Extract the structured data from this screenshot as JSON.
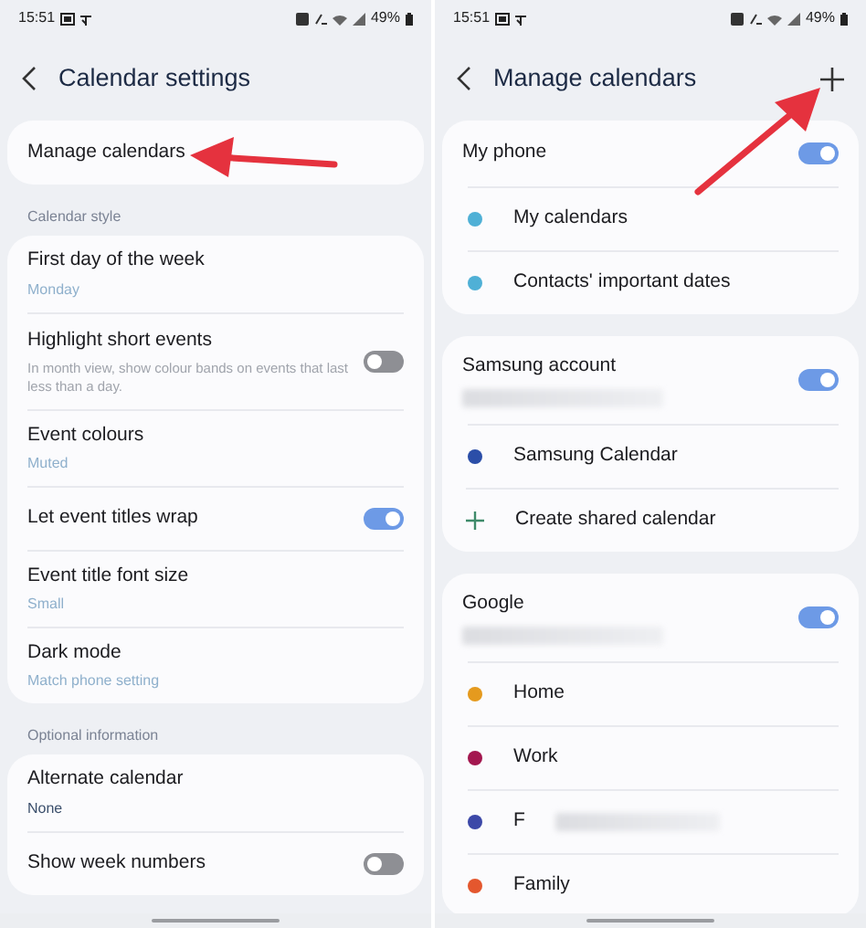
{
  "screens": [
    {
      "status_bar": {
        "time": "15:51",
        "battery": "49%"
      },
      "title": "Calendar settings",
      "add_button": false,
      "pointer_arrow": true,
      "sections": [
        {
          "items": [
            {
              "kind": "setting",
              "title": "Manage calendars"
            }
          ]
        },
        {
          "label": "Calendar style",
          "items": [
            {
              "kind": "setting",
              "title": "First day of the week",
              "value": "Monday"
            },
            {
              "kind": "setting",
              "title": "Highlight short events",
              "description": "In month view, show colour bands on events that last less than a day.",
              "toggle": {
                "on": false
              }
            },
            {
              "kind": "setting",
              "title": "Event colours",
              "value": "Muted"
            },
            {
              "kind": "setting",
              "title": "Let event titles wrap",
              "toggle": {
                "on": true
              }
            },
            {
              "kind": "setting",
              "title": "Event title font size",
              "value": "Small"
            },
            {
              "kind": "setting",
              "title": "Dark mode",
              "value": "Match phone setting"
            }
          ]
        },
        {
          "label": "Optional information",
          "items": [
            {
              "kind": "setting",
              "title": "Alternate calendar",
              "value": "None",
              "value_strong": true
            },
            {
              "kind": "setting",
              "title": "Show week numbers",
              "toggle": {
                "on": false
              }
            }
          ]
        }
      ]
    },
    {
      "status_bar": {
        "time": "15:51",
        "battery": "49%"
      },
      "title": "Manage calendars",
      "add_button": true,
      "pointer_arrow": true,
      "sections": [
        {
          "items": [
            {
              "kind": "account",
              "title": "My phone",
              "toggle": {
                "on": true
              }
            },
            {
              "kind": "calendar",
              "label": "My calendars",
              "color": "#4fb0d6"
            },
            {
              "kind": "calendar",
              "label": "Contacts' important dates",
              "color": "#4fb0d6"
            }
          ]
        },
        {
          "items": [
            {
              "kind": "account",
              "title": "Samsung account",
              "redacted": true,
              "toggle": {
                "on": true
              }
            },
            {
              "kind": "calendar",
              "label": "Samsung Calendar",
              "color": "#2b4ea8"
            },
            {
              "kind": "action",
              "label": "Create shared calendar"
            }
          ]
        },
        {
          "items": [
            {
              "kind": "account",
              "title": "Google",
              "redacted": true,
              "toggle": {
                "on": true
              }
            },
            {
              "kind": "calendar",
              "label": "Home",
              "color": "#e59a1e"
            },
            {
              "kind": "calendar",
              "label": "Work",
              "color": "#a3174f"
            },
            {
              "kind": "calendar",
              "label": "F",
              "color": "#3c48a8",
              "redacted": true
            },
            {
              "kind": "calendar",
              "label": "Family",
              "color": "#e4572e"
            }
          ]
        }
      ]
    }
  ]
}
